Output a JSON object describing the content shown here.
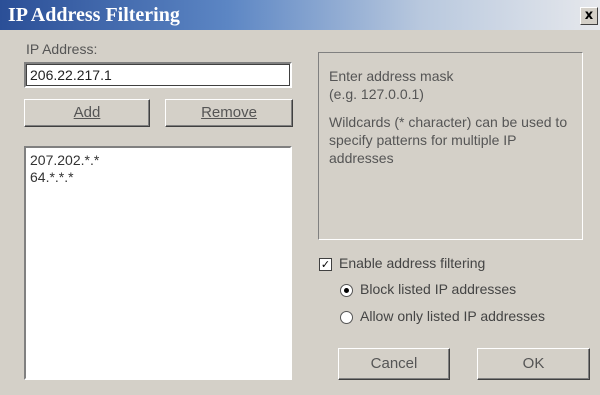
{
  "dialog": {
    "title": "IP Address Filtering",
    "close_glyph": "x"
  },
  "ip_address": {
    "label": "IP Address:",
    "value": "206.22.217.1"
  },
  "buttons": {
    "add_label": "Add",
    "remove_label": "Remove",
    "cancel_label": "Cancel",
    "ok_label": "OK"
  },
  "ip_list": {
    "items": [
      "207.202.*.*",
      "64.*.*.*"
    ]
  },
  "hint": {
    "line1": "Enter address mask",
    "line2": "(e.g. 127.0.0.1)",
    "paragraph2": "Wildcards (* character) can be used to specify patterns for multiple IP addresses"
  },
  "filtering": {
    "enable_label": "Enable address filtering",
    "enabled": true,
    "check_glyph": "✓",
    "options": [
      {
        "label": "Block listed IP addresses",
        "selected": true
      },
      {
        "label": "Allow only listed IP addresses",
        "selected": false
      }
    ]
  },
  "colors": {
    "titlebar_start": "#2b4f97",
    "dialog_face": "#d4d0c8"
  }
}
